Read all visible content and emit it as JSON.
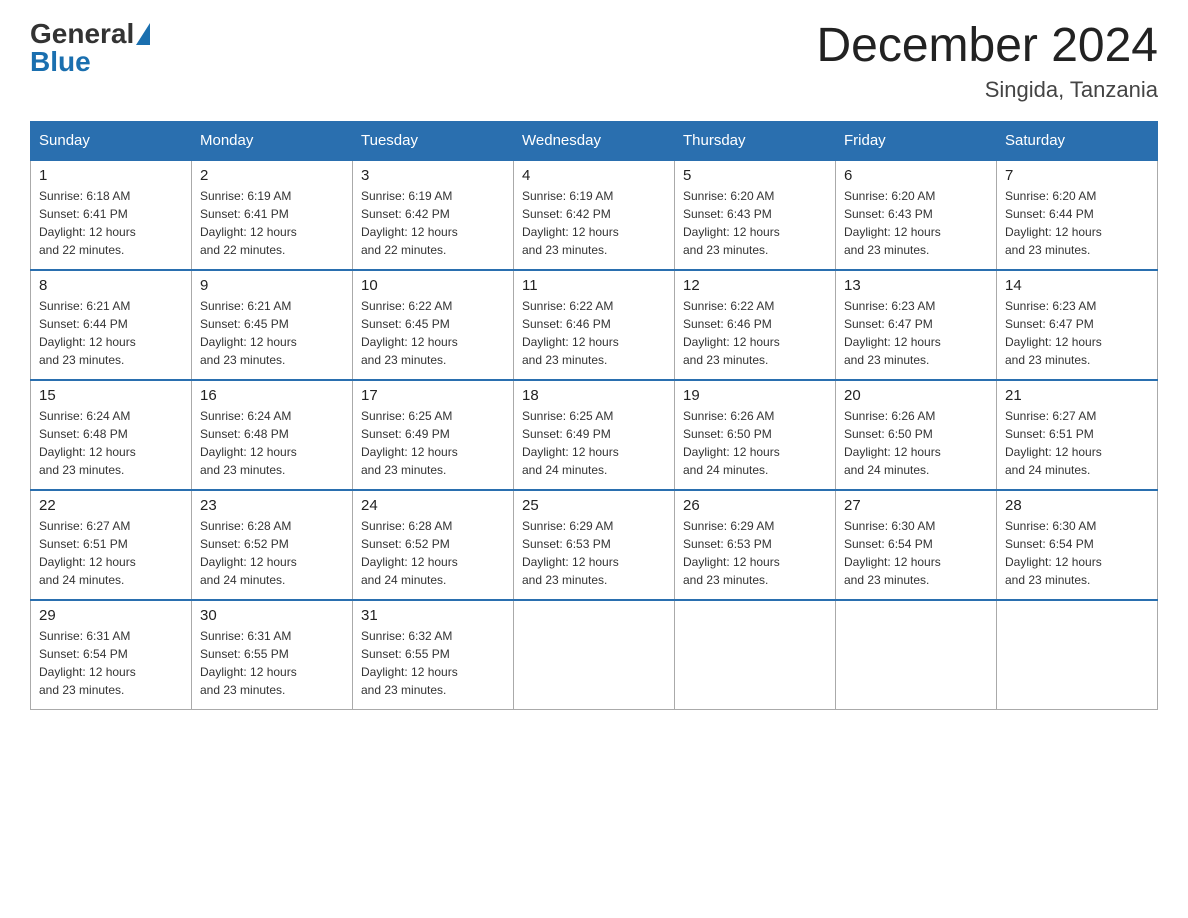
{
  "header": {
    "logo_general": "General",
    "logo_blue": "Blue",
    "month_title": "December 2024",
    "location": "Singida, Tanzania"
  },
  "weekdays": [
    "Sunday",
    "Monday",
    "Tuesday",
    "Wednesday",
    "Thursday",
    "Friday",
    "Saturday"
  ],
  "weeks": [
    [
      {
        "day": "1",
        "sunrise": "6:18 AM",
        "sunset": "6:41 PM",
        "daylight": "12 hours and 22 minutes."
      },
      {
        "day": "2",
        "sunrise": "6:19 AM",
        "sunset": "6:41 PM",
        "daylight": "12 hours and 22 minutes."
      },
      {
        "day": "3",
        "sunrise": "6:19 AM",
        "sunset": "6:42 PM",
        "daylight": "12 hours and 22 minutes."
      },
      {
        "day": "4",
        "sunrise": "6:19 AM",
        "sunset": "6:42 PM",
        "daylight": "12 hours and 23 minutes."
      },
      {
        "day": "5",
        "sunrise": "6:20 AM",
        "sunset": "6:43 PM",
        "daylight": "12 hours and 23 minutes."
      },
      {
        "day": "6",
        "sunrise": "6:20 AM",
        "sunset": "6:43 PM",
        "daylight": "12 hours and 23 minutes."
      },
      {
        "day": "7",
        "sunrise": "6:20 AM",
        "sunset": "6:44 PM",
        "daylight": "12 hours and 23 minutes."
      }
    ],
    [
      {
        "day": "8",
        "sunrise": "6:21 AM",
        "sunset": "6:44 PM",
        "daylight": "12 hours and 23 minutes."
      },
      {
        "day": "9",
        "sunrise": "6:21 AM",
        "sunset": "6:45 PM",
        "daylight": "12 hours and 23 minutes."
      },
      {
        "day": "10",
        "sunrise": "6:22 AM",
        "sunset": "6:45 PM",
        "daylight": "12 hours and 23 minutes."
      },
      {
        "day": "11",
        "sunrise": "6:22 AM",
        "sunset": "6:46 PM",
        "daylight": "12 hours and 23 minutes."
      },
      {
        "day": "12",
        "sunrise": "6:22 AM",
        "sunset": "6:46 PM",
        "daylight": "12 hours and 23 minutes."
      },
      {
        "day": "13",
        "sunrise": "6:23 AM",
        "sunset": "6:47 PM",
        "daylight": "12 hours and 23 minutes."
      },
      {
        "day": "14",
        "sunrise": "6:23 AM",
        "sunset": "6:47 PM",
        "daylight": "12 hours and 23 minutes."
      }
    ],
    [
      {
        "day": "15",
        "sunrise": "6:24 AM",
        "sunset": "6:48 PM",
        "daylight": "12 hours and 23 minutes."
      },
      {
        "day": "16",
        "sunrise": "6:24 AM",
        "sunset": "6:48 PM",
        "daylight": "12 hours and 23 minutes."
      },
      {
        "day": "17",
        "sunrise": "6:25 AM",
        "sunset": "6:49 PM",
        "daylight": "12 hours and 23 minutes."
      },
      {
        "day": "18",
        "sunrise": "6:25 AM",
        "sunset": "6:49 PM",
        "daylight": "12 hours and 24 minutes."
      },
      {
        "day": "19",
        "sunrise": "6:26 AM",
        "sunset": "6:50 PM",
        "daylight": "12 hours and 24 minutes."
      },
      {
        "day": "20",
        "sunrise": "6:26 AM",
        "sunset": "6:50 PM",
        "daylight": "12 hours and 24 minutes."
      },
      {
        "day": "21",
        "sunrise": "6:27 AM",
        "sunset": "6:51 PM",
        "daylight": "12 hours and 24 minutes."
      }
    ],
    [
      {
        "day": "22",
        "sunrise": "6:27 AM",
        "sunset": "6:51 PM",
        "daylight": "12 hours and 24 minutes."
      },
      {
        "day": "23",
        "sunrise": "6:28 AM",
        "sunset": "6:52 PM",
        "daylight": "12 hours and 24 minutes."
      },
      {
        "day": "24",
        "sunrise": "6:28 AM",
        "sunset": "6:52 PM",
        "daylight": "12 hours and 24 minutes."
      },
      {
        "day": "25",
        "sunrise": "6:29 AM",
        "sunset": "6:53 PM",
        "daylight": "12 hours and 23 minutes."
      },
      {
        "day": "26",
        "sunrise": "6:29 AM",
        "sunset": "6:53 PM",
        "daylight": "12 hours and 23 minutes."
      },
      {
        "day": "27",
        "sunrise": "6:30 AM",
        "sunset": "6:54 PM",
        "daylight": "12 hours and 23 minutes."
      },
      {
        "day": "28",
        "sunrise": "6:30 AM",
        "sunset": "6:54 PM",
        "daylight": "12 hours and 23 minutes."
      }
    ],
    [
      {
        "day": "29",
        "sunrise": "6:31 AM",
        "sunset": "6:54 PM",
        "daylight": "12 hours and 23 minutes."
      },
      {
        "day": "30",
        "sunrise": "6:31 AM",
        "sunset": "6:55 PM",
        "daylight": "12 hours and 23 minutes."
      },
      {
        "day": "31",
        "sunrise": "6:32 AM",
        "sunset": "6:55 PM",
        "daylight": "12 hours and 23 minutes."
      },
      null,
      null,
      null,
      null
    ]
  ],
  "labels": {
    "sunrise": "Sunrise:",
    "sunset": "Sunset:",
    "daylight": "Daylight:"
  }
}
